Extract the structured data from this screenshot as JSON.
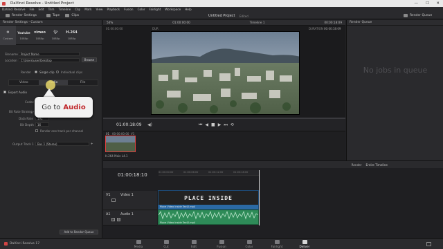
{
  "app": {
    "title": "DaVinci Resolve - Untitled Project",
    "version": "DaVinci Resolve 17"
  },
  "menu": [
    "DaVinci Resolve",
    "File",
    "Edit",
    "Trim",
    "Timeline",
    "Clip",
    "Mark",
    "View",
    "Playback",
    "Fusion",
    "Color",
    "Fairlight",
    "Workspace",
    "Help"
  ],
  "toolbar": {
    "render_settings": "Render Settings",
    "tape": "Tape",
    "clips": "Clips",
    "project": "Untitled Project",
    "edited": "Edited",
    "render_queue": "Render Queue"
  },
  "render_settings": {
    "panel_title": "Render Settings - Custom",
    "presets": [
      {
        "label": "Custom",
        "logo": ""
      },
      {
        "label": "1080p",
        "logo": "Youtube"
      },
      {
        "label": "1080p",
        "logo": "vimeo"
      },
      {
        "label": "1080p",
        "logo": "twitter"
      },
      {
        "label": "1080p",
        "logo": "H.264"
      }
    ],
    "filename_label": "Filename",
    "filename_value": "Project Name",
    "location_label": "Location",
    "location_value": "C:\\Users\\user\\Desktop",
    "browse": "Browse",
    "render_label": "Render",
    "single_clip": "Single clip",
    "individual_clips": "Individual clips",
    "tabs": [
      "Video",
      "Audio",
      "File"
    ],
    "export_audio": "Export Audio",
    "codec_label": "Codec",
    "bitrate_label": "Bit Rate Strategy",
    "datarate_label": "Data Rate",
    "datarate_value": "192",
    "bitdepth_label": "Bit Depth",
    "bitdepth_value": "16",
    "one_track": "Render one track per channel",
    "output_track_label": "Output Track 1",
    "output_track_value": "Bus 1 (Stereo)",
    "add_queue": "Add to Render Queue"
  },
  "callout": {
    "prefix": "Go to",
    "highlight": "Audio"
  },
  "viewer": {
    "zoom": "54%",
    "tc_left": "01:00:00:00",
    "duration": "DUR",
    "tc_center_label": "Timeline 1",
    "tc_right": "00:00:18:09",
    "duration_label": "DURATION",
    "duration_value": "00:00:18:09",
    "current_tc": "01:00:18:09"
  },
  "render_queue": {
    "title": "Render Queue",
    "empty": "No jobs in queue"
  },
  "clip": {
    "index": "01",
    "tc": "00:00:00:00",
    "track": "V1",
    "name": "H.264 Main L4.1"
  },
  "timeline": {
    "tc": "01:00:18:10",
    "render_label": "Render",
    "range": "Entire Timeline",
    "v1_label": "V1",
    "v1_name": "Video 1",
    "a1_label": "A1",
    "a1_name": "Audio 1",
    "clip_title": "PLACE INSIDE",
    "clip_file": "Place Video Inside Text2.mp4",
    "ruler": [
      "01:00:00:00",
      "01:00:06:00",
      "01:00:12:00",
      "01:00:18:00"
    ]
  },
  "pages": [
    "Media",
    "Cut",
    "Edit",
    "Fusion",
    "Color",
    "Fairlight",
    "Deliver"
  ],
  "active_page": "Deliver",
  "colors": {
    "accent": "#c0282c",
    "video_clip": "#2b6aa4",
    "audio_clip": "#2e8b58"
  }
}
